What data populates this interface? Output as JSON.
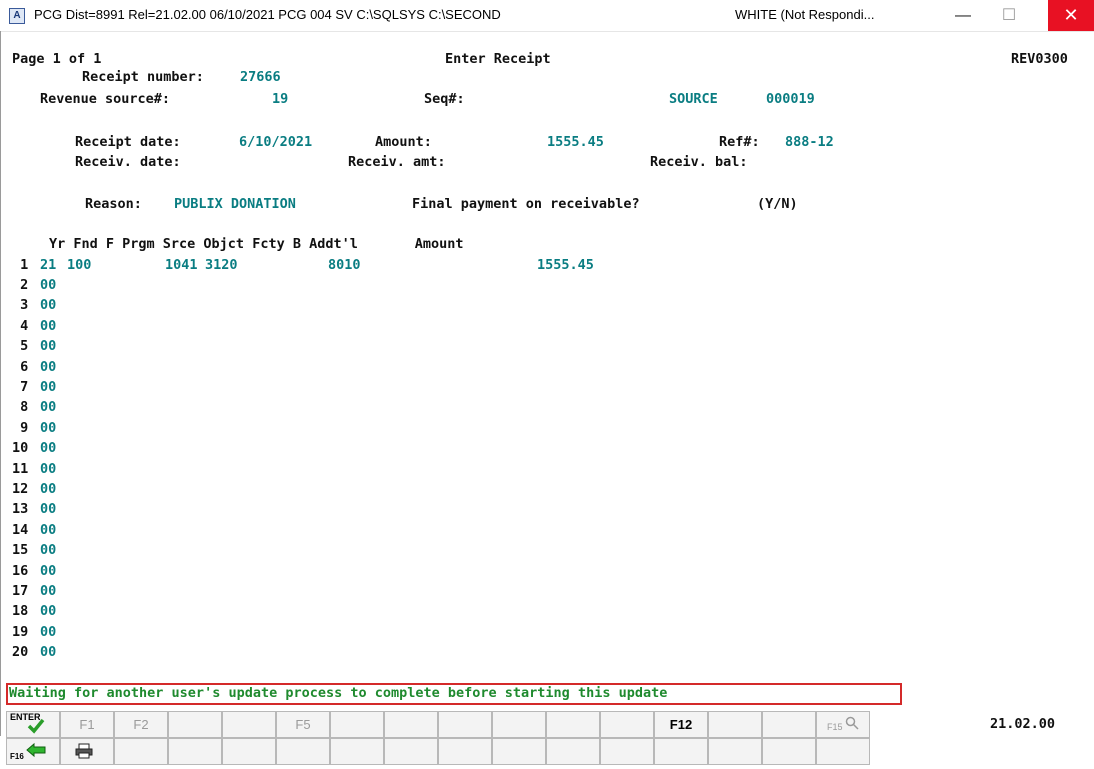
{
  "window": {
    "title": "PCG Dist=8991  Rel=21.02.00  06/10/2021  PCG 004  SV C:\\SQLSYS  C:\\SECOND",
    "status": "WHITE (Not Respondi...",
    "app_icon": "A"
  },
  "header": {
    "page": "Page 1 of 1",
    "screen_title": "Enter Receipt",
    "screen_id": "REV0300"
  },
  "receipt": {
    "number_label": "Receipt number:",
    "number": "27666",
    "source_label": "Revenue source#:",
    "source": "19",
    "seq_label": "Seq#:",
    "source_name": "SOURCE",
    "source_code": "000019",
    "date_label": "Receipt date:",
    "date": "6/10/2021",
    "amount_label": "Amount:",
    "amount": "1555.45",
    "ref_label": "Ref#:",
    "ref": "888-12",
    "receiv_date_label": "Receiv. date:",
    "receiv_amt_label": "Receiv. amt:",
    "receiv_bal_label": "Receiv. bal:",
    "reason_label": "Reason:",
    "reason": "PUBLIX DONATION",
    "final_label": "Final payment on receivable?",
    "final_hint": "(Y/N)"
  },
  "table": {
    "header": "Yr Fnd F Prgm Srce Objct Fcty B Addt'l       Amount",
    "row1": {
      "num": " 1",
      "yr": "21",
      "fnd": "100",
      "prgm": "1041",
      "srce": "3120",
      "fcty": "8010",
      "amount": "1555.45"
    },
    "empty_rows": [
      {
        "num": " 2",
        "yr": "00"
      },
      {
        "num": " 3",
        "yr": "00"
      },
      {
        "num": " 4",
        "yr": "00"
      },
      {
        "num": " 5",
        "yr": "00"
      },
      {
        "num": " 6",
        "yr": "00"
      },
      {
        "num": " 7",
        "yr": "00"
      },
      {
        "num": " 8",
        "yr": "00"
      },
      {
        "num": " 9",
        "yr": "00"
      },
      {
        "num": "10",
        "yr": "00"
      },
      {
        "num": "11",
        "yr": "00"
      },
      {
        "num": "12",
        "yr": "00"
      },
      {
        "num": "13",
        "yr": "00"
      },
      {
        "num": "14",
        "yr": "00"
      },
      {
        "num": "15",
        "yr": "00"
      },
      {
        "num": "16",
        "yr": "00"
      },
      {
        "num": "17",
        "yr": "00"
      },
      {
        "num": "18",
        "yr": "00"
      },
      {
        "num": "19",
        "yr": "00"
      },
      {
        "num": "20",
        "yr": "00"
      }
    ]
  },
  "message": "Waiting for another user's update process to complete before starting this update",
  "fkeys": {
    "enter": "ENTER",
    "f1": "F1",
    "f2": "F2",
    "f5": "F5",
    "f12": "F12",
    "f15": "F15",
    "f16": "F16"
  },
  "version": "21.02.00"
}
